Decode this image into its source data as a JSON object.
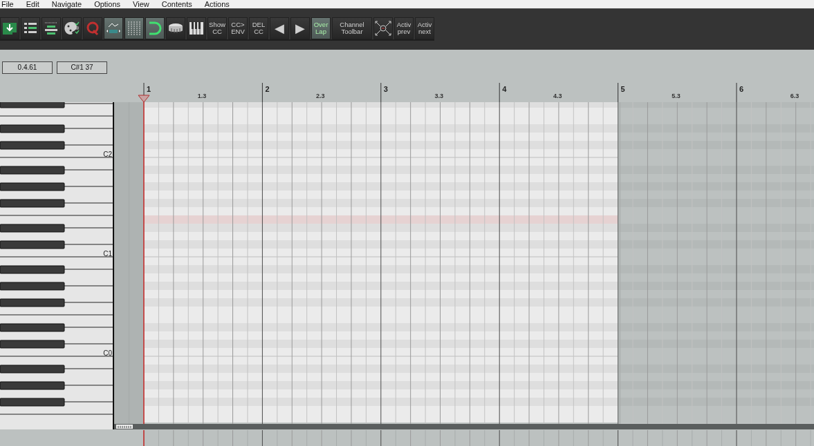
{
  "menu": [
    "File",
    "Edit",
    "Navigate",
    "Options",
    "View",
    "Contents",
    "Actions"
  ],
  "toolbar": [
    {
      "kind": "icon",
      "selected": false
    },
    {
      "kind": "icon",
      "selected": false
    },
    {
      "kind": "icon",
      "selected": false
    },
    {
      "kind": "icon",
      "selected": false
    },
    {
      "kind": "icon",
      "selected": false
    },
    {
      "kind": "icon",
      "selected": true
    },
    {
      "kind": "icon",
      "selected": true
    },
    {
      "kind": "icon",
      "selected": true
    },
    {
      "kind": "icon",
      "selected": false
    },
    {
      "kind": "icon",
      "selected": false
    },
    {
      "kind": "text",
      "lines": [
        "Show",
        "CC"
      ],
      "selected": false
    },
    {
      "kind": "text",
      "lines": [
        "CC>",
        "ENV"
      ],
      "selected": false
    },
    {
      "kind": "text",
      "lines": [
        "DEL",
        "CC"
      ],
      "selected": false
    },
    {
      "kind": "text",
      "lines": [
        "◀"
      ],
      "selected": false
    },
    {
      "kind": "text",
      "lines": [
        "▶"
      ],
      "selected": false
    },
    {
      "kind": "text",
      "lines": [
        "Over",
        "Lap"
      ],
      "selected": true
    },
    {
      "kind": "text",
      "lines": [
        "Channel",
        "Toolbar"
      ],
      "selected": false
    },
    {
      "kind": "icon",
      "selected": false
    },
    {
      "kind": "text",
      "lines": [
        "Activ",
        "prev"
      ],
      "selected": false
    },
    {
      "kind": "text",
      "lines": [
        "Activ",
        "next"
      ],
      "selected": false
    }
  ],
  "position_field": "0.4.61",
  "note_field": "C#1  37",
  "ruler": [
    "1",
    "1.3",
    "2",
    "2.3",
    "3",
    "3.3",
    "4",
    "4.3",
    "5",
    "5.3",
    "6",
    "6.3"
  ],
  "octave_labels": [
    "C2",
    "C1",
    "C0"
  ]
}
